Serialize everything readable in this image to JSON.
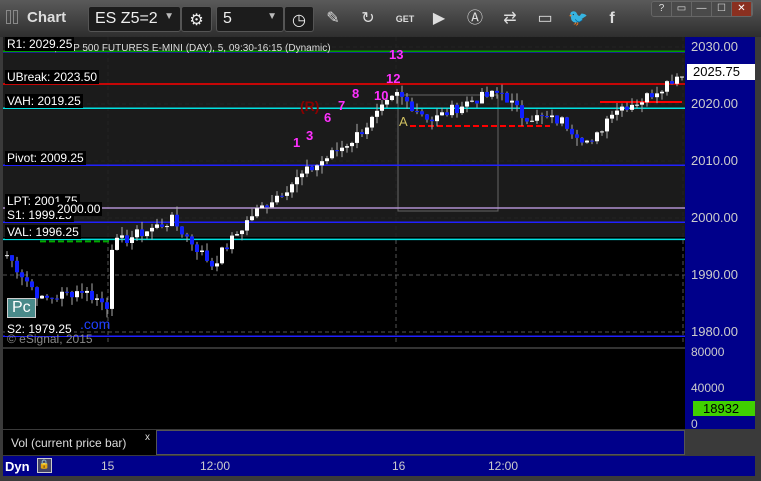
{
  "window": {
    "title": "Chart",
    "symbol": "ES Z5=2",
    "interval": "5",
    "buttons": [
      "?",
      "▭",
      "—",
      "☐",
      "✕"
    ]
  },
  "toolbar_icons": [
    "settings-icon",
    "clock-icon",
    "pencil-icon",
    "refresh-icon",
    "get-icon",
    "play-icon",
    "alert-icon",
    "link-icon",
    "comment-icon",
    "twitter-icon",
    "facebook-icon"
  ],
  "chart": {
    "header": "ES Z5=2, S&P 500 FUTURES E-MINI (DAY), 5, 09:30-16:15 (Dynamic)",
    "last_price": "2025.75",
    "price_ticks": [
      "2030.00",
      "2020.00",
      "2010.00",
      "2000.00",
      "1990.00",
      "1980.00"
    ],
    "levels": [
      {
        "label": "R1: 2029.25",
        "price": 2029.25,
        "color": "#00a000"
      },
      {
        "label": "UBreak: 2023.50",
        "price": 2023.5,
        "color": "#ff0000"
      },
      {
        "label": "VAH: 2019.25",
        "price": 2019.25,
        "color": "#00e0e0"
      },
      {
        "label": "Pivot: 2009.25",
        "price": 2009.25,
        "color": "#2020ff"
      },
      {
        "label": "LPT: 2001.75",
        "price": 2001.75,
        "color": "#b090d0"
      },
      {
        "label": "S1: 1999.25",
        "price": 1999.25,
        "color": "#2020ff"
      },
      {
        "label": "VAL: 1996.25",
        "price": 1996.25,
        "color": "#00e0e0"
      },
      {
        "label": "S2: 1979.25",
        "price": 1979.25,
        "color": "#2020ff"
      }
    ],
    "overlay_label": "2000.00",
    "pc_badge": "Pc",
    "watermark": ".com",
    "copyright": "© eSignal, 2015",
    "marker_A": "A",
    "marker_R": "(R)",
    "seq_labels": [
      "1",
      "3",
      "6",
      "7",
      "8",
      "10",
      "12",
      "13"
    ],
    "price_path": [
      [
        0,
        1993.5
      ],
      [
        7,
        1985.6
      ],
      [
        15,
        1987.4
      ],
      [
        20,
        1984.7
      ],
      [
        21,
        1995.3
      ],
      [
        33,
        1999.6
      ],
      [
        41,
        1991.8
      ],
      [
        49,
        2000.5
      ],
      [
        59,
        2007.5
      ],
      [
        69,
        2013.7
      ],
      [
        78,
        2021.6
      ],
      [
        85,
        2017.2
      ],
      [
        93,
        2020.7
      ],
      [
        99,
        2022
      ],
      [
        103,
        2018
      ],
      [
        111,
        2017
      ],
      [
        117,
        2012.8
      ],
      [
        121,
        2019
      ],
      [
        127,
        2020.7
      ],
      [
        135,
        2025.6
      ]
    ]
  },
  "volume": {
    "label": "Vol (current price bar)",
    "close": "x",
    "ticks": [
      "80000",
      "40000",
      "0"
    ],
    "current": "18932",
    "max": 80000
  },
  "time_axis": {
    "mode": "Dyn",
    "labels": [
      "15",
      "12:00",
      "16",
      "12:00"
    ]
  }
}
